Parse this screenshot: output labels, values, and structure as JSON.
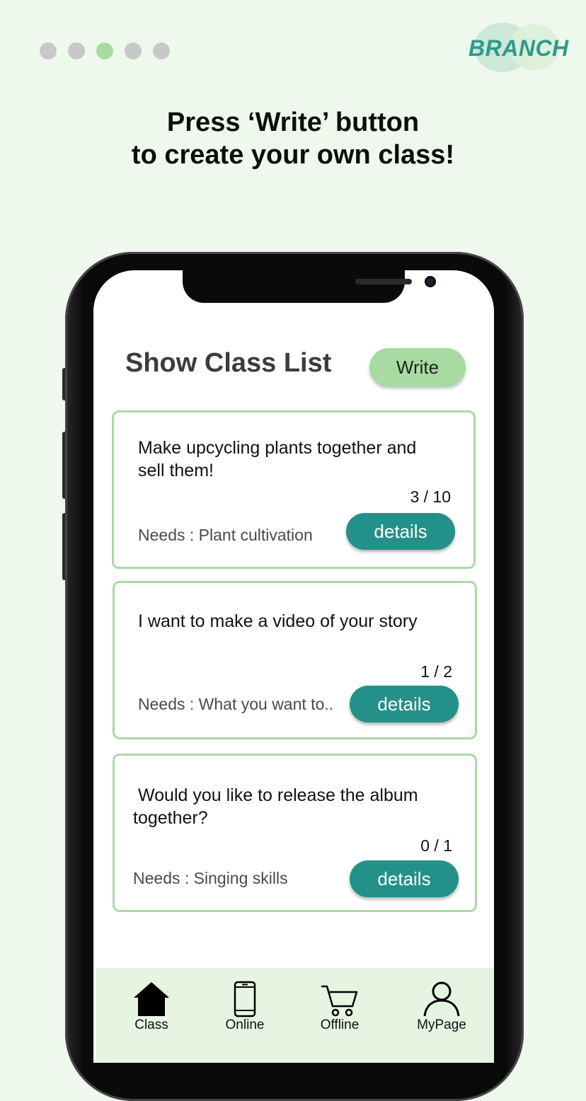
{
  "pagination": {
    "total": 5,
    "active_index": 2
  },
  "brand": {
    "logo_text": "BRANCH"
  },
  "headline": {
    "line1": "Press ‘Write’ button",
    "line2": "to create your own class!"
  },
  "screen": {
    "title": "Show Class List",
    "write_label": "Write",
    "classes": [
      {
        "title_line1": "Make upcycling plants together and",
        "title_line2": "sell them!",
        "count": "3 / 10",
        "needs": "Needs : Plant cultivation",
        "details_label": "details"
      },
      {
        "title_line1": "I want to make a video of your story",
        "title_line2": "",
        "count": "1 / 2",
        "needs": "Needs : What you want to..",
        "details_label": "details"
      },
      {
        "title_line1": "Would you like to release the album",
        "title_line2": "together?",
        "count": "0 / 1",
        "needs": "Needs : Singing skills",
        "details_label": "details"
      }
    ],
    "nav": [
      {
        "label": "Class",
        "icon": "home-icon",
        "active": true
      },
      {
        "label": "Online",
        "icon": "phone-icon",
        "active": false
      },
      {
        "label": "Offline",
        "icon": "cart-icon",
        "active": false
      },
      {
        "label": "MyPage",
        "icon": "user-icon",
        "active": false
      }
    ]
  },
  "colors": {
    "background": "#eef8ec",
    "accent_green": "#a8dba2",
    "teal": "#24908a",
    "dot_inactive": "#c8c8c8"
  }
}
